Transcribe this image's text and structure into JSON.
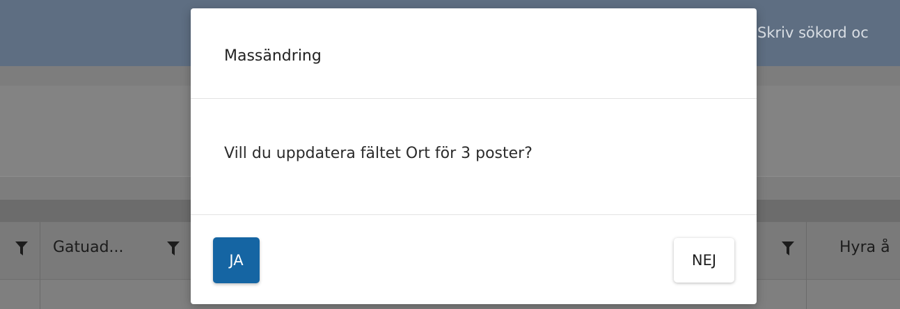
{
  "background": {
    "search_placeholder": "Skriv sökord oc",
    "grid_header": {
      "col_gatuadress": "Gatuad...",
      "col_hyra": "Hyra å"
    }
  },
  "dialog": {
    "title": "Massändring",
    "message": "Vill du uppdatera fältet Ort för 3 poster?",
    "confirm_label": "JA",
    "cancel_label": "NEJ"
  },
  "colors": {
    "confirm_button": "#1565a3",
    "overlay_header": "#5e6e82"
  }
}
